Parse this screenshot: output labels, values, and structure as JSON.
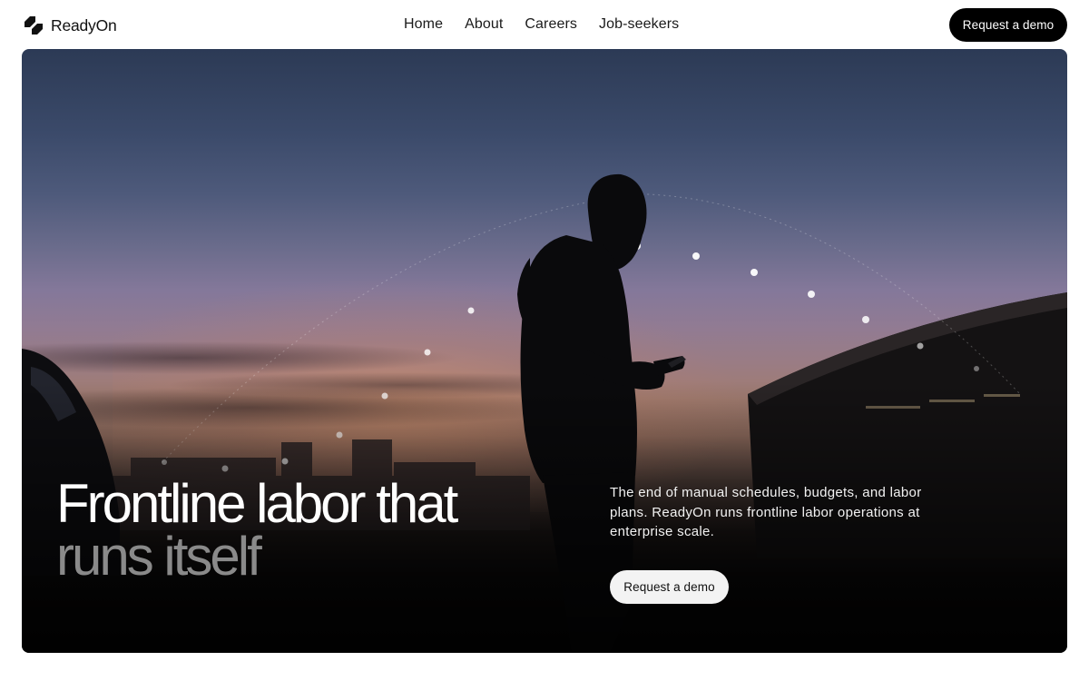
{
  "brand": {
    "name": "ReadyOn",
    "logo_icon": "readyon-logo-icon"
  },
  "nav": {
    "items": [
      {
        "label": "Home"
      },
      {
        "label": "About"
      },
      {
        "label": "Careers"
      },
      {
        "label": "Job-seekers"
      }
    ]
  },
  "header": {
    "cta_label": "Request a demo"
  },
  "hero": {
    "title_line1": "Frontline labor that",
    "title_line2": "runs itself",
    "description": "The end of manual schedules, budgets, and labor plans. ReadyOn runs frontline labor operations at enterprise scale.",
    "cta_label": "Request a demo",
    "background": "dusk-silhouette-photo"
  },
  "colors": {
    "cta_dark": "#000000",
    "cta_light": "#f3f3f3",
    "title_primary": "#ffffff",
    "title_secondary": "#8a8a8a"
  }
}
